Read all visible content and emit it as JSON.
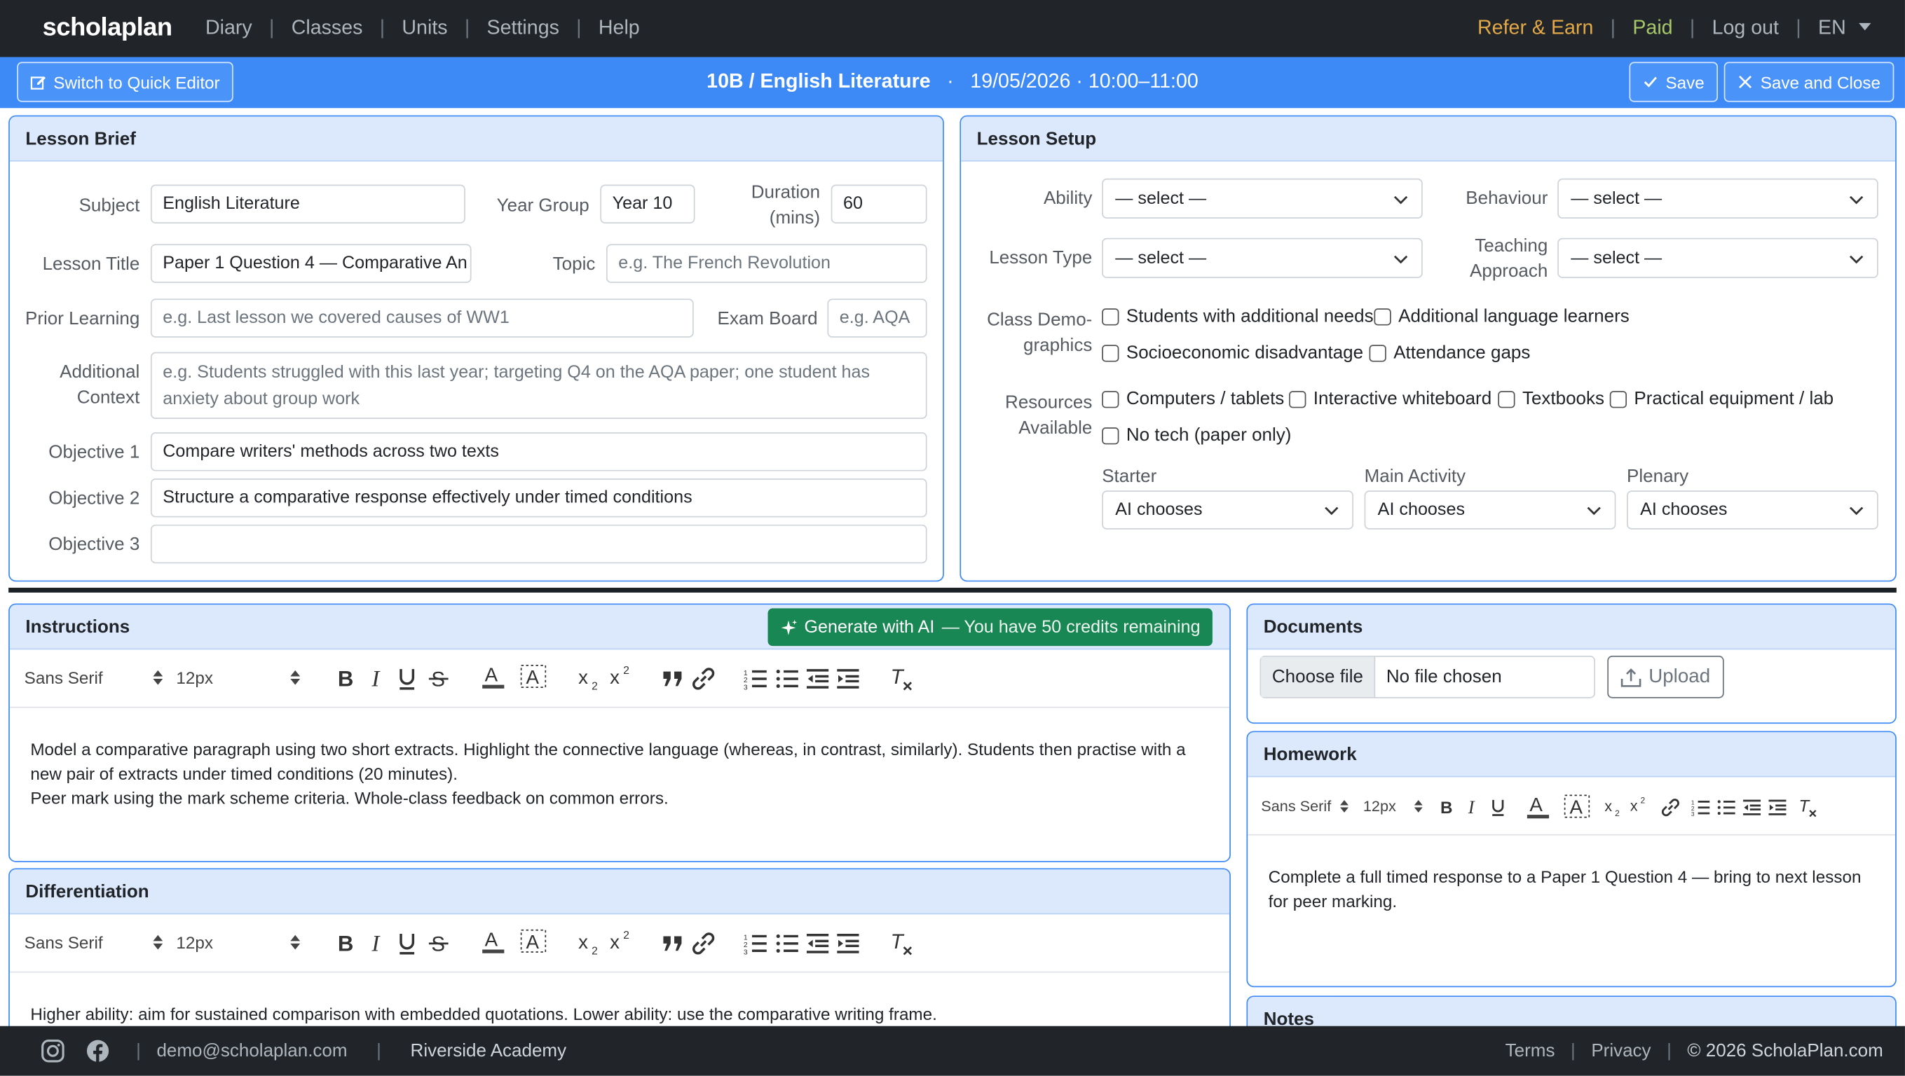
{
  "nav": {
    "brand": "scholaplan",
    "links": [
      "Diary",
      "Classes",
      "Units",
      "Settings",
      "Help"
    ],
    "refer": "Refer & Earn",
    "paid": "Paid",
    "logout": "Log out",
    "lang": "EN"
  },
  "bar": {
    "quick_editor": "Switch to Quick Editor",
    "class_subject": "10B / English Literature",
    "dot": "·",
    "when": "19/05/2026 · 10:00–11:00",
    "save": "Save",
    "save_close": "Save and Close"
  },
  "brief": {
    "title": "Lesson Brief",
    "subject_label": "Subject",
    "subject_value": "English Literature",
    "year_label": "Year Group",
    "year_value": "Year 10",
    "duration_label_1": "Duration",
    "duration_label_2": "(mins)",
    "duration_value": "60",
    "lesson_title_label": "Lesson Title",
    "lesson_title_value": "Paper 1 Question 4 — Comparative An",
    "topic_label": "Topic",
    "topic_placeholder": "e.g. The French Revolution",
    "prior_label": "Prior Learning",
    "prior_placeholder": "e.g. Last lesson we covered causes of WW1",
    "exam_label": "Exam Board",
    "exam_placeholder": "e.g. AQA",
    "context_label_1": "Additional",
    "context_label_2": "Context",
    "context_placeholder": "e.g. Students struggled with this last year; targeting Q4 on the AQA paper; one student has anxiety about group work",
    "obj1_label": "Objective 1",
    "obj1_value": "Compare writers' methods across two texts",
    "obj2_label": "Objective 2",
    "obj2_value": "Structure a comparative response effectively under timed conditions",
    "obj3_label": "Objective 3",
    "obj3_value": ""
  },
  "setup": {
    "title": "Lesson Setup",
    "ability_label": "Ability",
    "ability_value": "— select —",
    "behaviour_label": "Behaviour",
    "behaviour_value": "— select —",
    "type_label": "Lesson Type",
    "type_value": "— select —",
    "approach_label_1": "Teaching",
    "approach_label_2": "Approach",
    "approach_value": "— select —",
    "demo_label_1": "Class Demo-",
    "demo_label_2": "graphics",
    "demo_opts": [
      "Students with additional needs",
      "Additional language learners",
      "Socioeconomic disadvantage",
      "Attendance gaps"
    ],
    "res_label_1": "Resources",
    "res_label_2": "Available",
    "res_opts": [
      "Computers / tablets",
      "Interactive whiteboard",
      "Textbooks",
      "Practical equipment / lab",
      "No tech (paper only)"
    ],
    "starter_label": "Starter",
    "starter_value": "AI chooses",
    "main_label": "Main Activity",
    "main_value": "AI chooses",
    "plenary_label": "Plenary",
    "plenary_value": "AI chooses"
  },
  "toolbar": {
    "font": "Sans Serif",
    "size": "12px"
  },
  "instructions": {
    "title": "Instructions",
    "generate": "Generate with AI",
    "credits": "— You have 50 credits remaining",
    "line1": "Model a comparative paragraph using two short extracts. Highlight the connective language (whereas, in contrast, similarly). Students then practise with a",
    "line2": "new pair of extracts under timed conditions (20 minutes).",
    "line3": "Peer mark using the mark scheme criteria. Whole-class feedback on common errors."
  },
  "differentiation": {
    "title": "Differentiation",
    "line1": "Higher ability: aim for sustained comparison with embedded quotations. Lower ability: use the comparative writing frame."
  },
  "documents": {
    "title": "Documents",
    "choose": "Choose file",
    "none": "No file chosen",
    "upload": "Upload"
  },
  "homework": {
    "title": "Homework",
    "line1": "Complete a full timed response to a Paper 1 Question 4 — bring to next lesson",
    "line2": "for peer marking."
  },
  "notes": {
    "title": "Notes"
  },
  "footer": {
    "email": "demo@scholaplan.com",
    "school": "Riverside Academy",
    "terms": "Terms",
    "privacy": "Privacy",
    "copyright": "© 2026 ScholaPlan.com"
  },
  "colors": {
    "nav": "#212529",
    "accent": "#3d8af7",
    "header_bg": "#dce9fd",
    "generate": "#198754",
    "refer": "#e3a847",
    "paid": "#a6c86b"
  }
}
